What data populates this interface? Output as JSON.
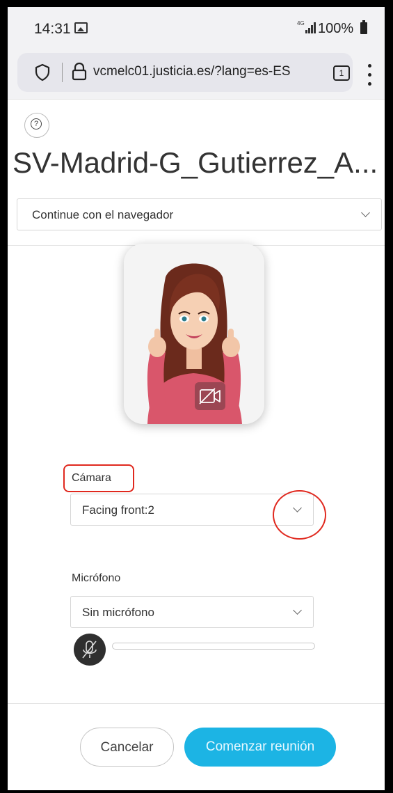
{
  "status_bar": {
    "time": "14:31",
    "network_type": "4G",
    "battery": "100%"
  },
  "browser": {
    "url": "vcmelc01.justicia.es/?lang=es-ES",
    "tab_count": "1"
  },
  "help": {
    "icon": "?"
  },
  "meeting": {
    "title": "SV-Madrid-G_Gutierrez_A...",
    "join_option": "Continue con el navegador"
  },
  "camera": {
    "label": "Cámara",
    "selected": "Facing front:2"
  },
  "microphone": {
    "label": "Micrófono",
    "selected": "Sin micrófono",
    "level": 0
  },
  "actions": {
    "cancel": "Cancelar",
    "start": "Comenzar reunión"
  },
  "colors": {
    "accent": "#1cb4e4",
    "annotation": "#e0281e"
  }
}
